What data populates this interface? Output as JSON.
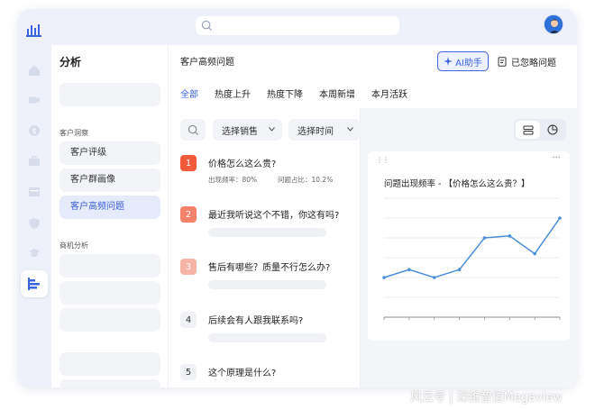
{
  "search": {
    "placeholder": ""
  },
  "sidebar": {
    "title": "分析",
    "group1_label": "客户洞察",
    "group2_label": "商机分析",
    "items": [
      {
        "label": "客户评级"
      },
      {
        "label": "客户群画像"
      },
      {
        "label": "客户高频问题"
      }
    ]
  },
  "main": {
    "title": "客户高频问题",
    "ai_button": "AI助手",
    "ignored_button": "已忽略问题",
    "tabs": [
      {
        "label": "全部"
      },
      {
        "label": "热度上升"
      },
      {
        "label": "热度下降"
      },
      {
        "label": "本周新增"
      },
      {
        "label": "本月活跃"
      }
    ],
    "filters": {
      "sales_select": "选择销售",
      "time_select": "选择时间"
    },
    "questions": [
      {
        "num": "1",
        "text": "价格怎么这么贵?",
        "rate": "出现频率：80%",
        "share": "问题占比：10.2%",
        "color": "#f15a3a"
      },
      {
        "num": "2",
        "text": "最近我听说这个不错，你这有吗?",
        "color": "#f4826a"
      },
      {
        "num": "3",
        "text": "售后有哪些？质量不行怎么办?",
        "color": "#f6b3a6"
      },
      {
        "num": "4",
        "text": "后续会有人跟我联系吗?",
        "color": "#f1f2f5"
      },
      {
        "num": "5",
        "text": "这个原理是什么?",
        "color": "#f1f2f5"
      }
    ]
  },
  "chart_data": {
    "type": "line",
    "title": "问题出现频率 - 【价格怎么这么贵？】",
    "xlabel": "",
    "ylabel": "",
    "x": [
      1,
      2,
      3,
      4,
      5,
      6,
      7,
      8
    ],
    "values": [
      2.0,
      2.4,
      2.0,
      2.4,
      4.0,
      4.1,
      3.2,
      5.0
    ],
    "ylim": [
      0,
      6
    ],
    "grid": true,
    "line_color": "#4a8fd6"
  },
  "watermark": "风云号 | 深维智信Megaview",
  "colors": {
    "accent": "#3b64e0"
  }
}
